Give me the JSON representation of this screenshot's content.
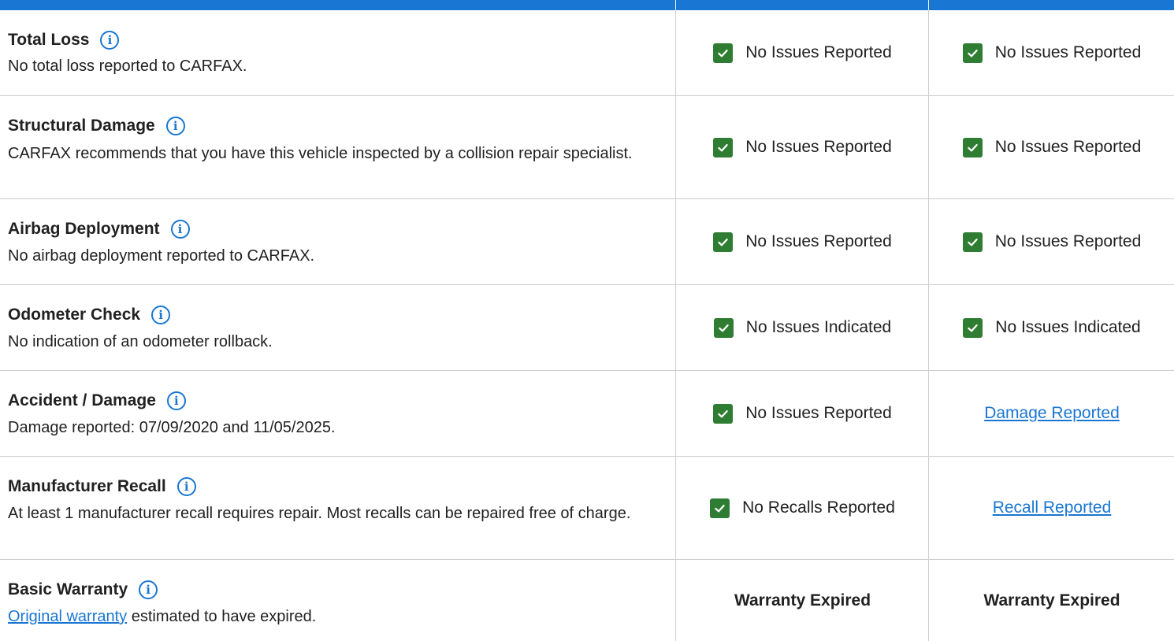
{
  "colors": {
    "header": "#1976d2",
    "check": "#2e7d32",
    "link": "#1976d2",
    "divider": "#cfcfcf"
  },
  "rows": [
    {
      "title": "Total Loss",
      "description": "No total loss reported to CARFAX.",
      "status_a": "No Issues Reported",
      "status_b": "No Issues Reported"
    },
    {
      "title": "Structural Damage",
      "description": "CARFAX recommends that you have this vehicle inspected by a collision repair specialist.",
      "status_a": "No Issues Reported",
      "status_b": "No Issues Reported"
    },
    {
      "title": "Airbag Deployment",
      "description": "No airbag deployment reported to CARFAX.",
      "status_a": "No Issues Reported",
      "status_b": "No Issues Reported"
    },
    {
      "title": "Odometer Check",
      "description": "No indication of an odometer rollback.",
      "status_a": "No Issues Indicated",
      "status_b": "No Issues Indicated"
    },
    {
      "title": "Accident / Damage",
      "description": "Damage reported: 07/09/2020 and 11/05/2025.",
      "status_a": "No Issues Reported",
      "status_b": "Damage Reported"
    },
    {
      "title": "Manufacturer Recall",
      "description": "At least 1 manufacturer recall requires repair. Most recalls can be repaired free of charge.",
      "status_a": "No Recalls Reported",
      "status_b": "Recall Reported"
    },
    {
      "title": "Basic Warranty",
      "description_link": "Original warranty",
      "description": "estimated to have expired.",
      "status_a": "Warranty Expired",
      "status_b": "Warranty Expired"
    }
  ],
  "icons": {
    "info": "info-circle-icon",
    "check": "green-check-icon"
  }
}
